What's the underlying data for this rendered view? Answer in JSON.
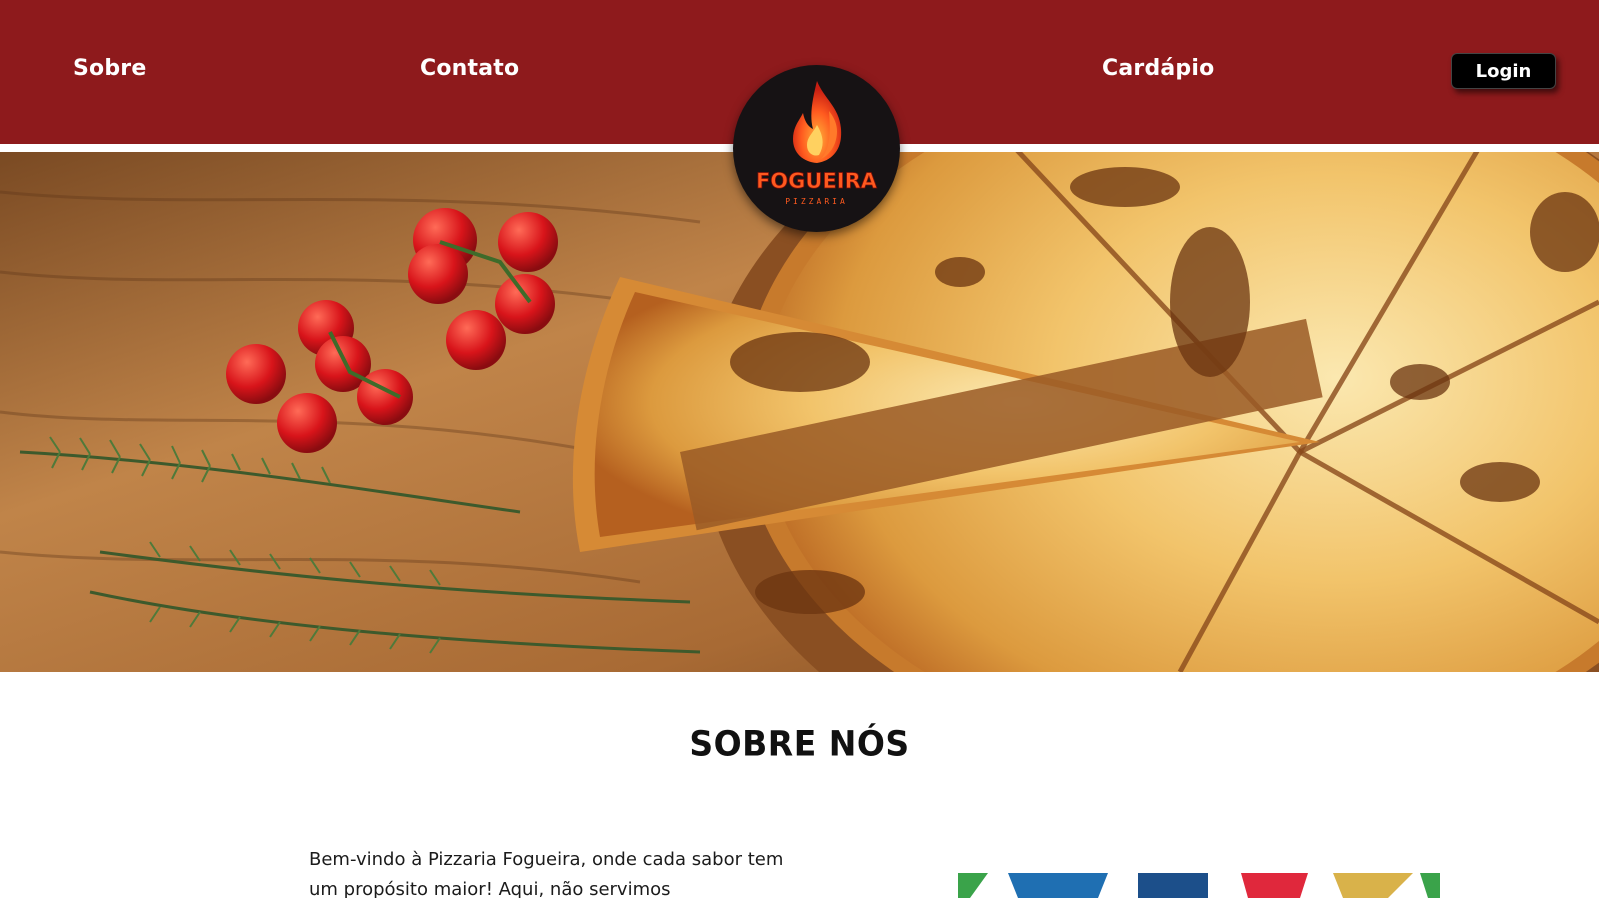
{
  "nav": {
    "sobre": "Sobre",
    "contato": "Contato",
    "cardapio": "Cardápio",
    "login": "Login"
  },
  "logo": {
    "name": "FOGUEIRA",
    "tagline": "PIZZARIA",
    "icon": "flame-icon"
  },
  "hero": {
    "image": "pizza-on-wooden-board-with-tomatoes-and-rosemary"
  },
  "about": {
    "title": "SOBRE NÓS",
    "paragraph": "Bem-vindo à Pizzaria Fogueira, onde cada sabor tem um propósito maior! Aqui, não servimos"
  },
  "colors": {
    "header": "#8e1a1c",
    "button": "#000000",
    "logo_bg": "#161214",
    "flame": "#e8421b"
  }
}
